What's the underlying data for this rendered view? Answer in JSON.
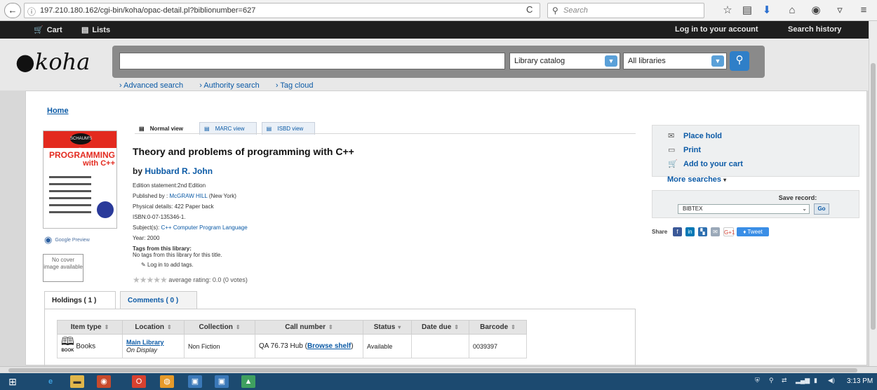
{
  "browser": {
    "back_glyph": "←",
    "info_glyph": "ⓘ",
    "url": "197.210.180.162/cgi-bin/koha/opac-detail.pl?biblionumber=627",
    "reload_glyph": "C",
    "search_placeholder": "Search",
    "toolbar_icons": [
      "star-icon",
      "reading-list-icon",
      "download-icon",
      "home-icon",
      "pocket-icon",
      "shield-icon",
      "menu-icon"
    ]
  },
  "topnav": {
    "cart_label": "Cart",
    "lists_label": "Lists",
    "login_label": "Log in to your account",
    "history_label": "Search history"
  },
  "header": {
    "logo_text": "koha",
    "search_value": "",
    "catalog_select": "Library catalog",
    "library_select": "All libraries",
    "more_links": [
      "Advanced search",
      "Authority search",
      "Tag cloud"
    ]
  },
  "main": {
    "breadcrumb": "Home",
    "views": [
      "Normal view",
      "MARC view",
      "ISBD view"
    ],
    "cover": {
      "brand": "SCHAUM'S outlines",
      "line1": "PROGRAMMING",
      "line2": "with C++"
    },
    "google_preview": "Google Preview",
    "no_cover": "No cover image available",
    "title": "Theory and problems of programming with C++",
    "author_prefix": "by",
    "author": "Hubbard R. John",
    "edition": "Edition statement:2nd Edition",
    "published_prefix": "Published by :",
    "publisher": "McGRAW HILL",
    "published_place": "(New York)",
    "physical": "Physical details: 422 Paper back",
    "isbn": "ISBN:0-07-135346-1.",
    "subject_prefix": "Subject(s):",
    "subject": "C++ Computer Program Language",
    "year": "Year: 2000",
    "tags_heading": "Tags from this library:",
    "tags_none": "No tags from this library for this title.",
    "tags_login": "Log in to add tags.",
    "rating_text": "average rating: 0.0 (0 votes)"
  },
  "sidebar": {
    "place_hold": "Place hold",
    "print": "Print",
    "add_to_cart": "Add to your cart",
    "more_searches": "More searches",
    "save_label": "Save record:",
    "save_format": "BIBTEX",
    "save_go": "Go",
    "share_label": "Share",
    "tweet_label": "Tweet",
    "gplus_label": "G+1"
  },
  "holdings": {
    "tab_holdings": "Holdings ( 1 )",
    "tab_comments": "Comments ( 0 )",
    "columns": [
      "Item type",
      "Location",
      "Collection",
      "Call number",
      "Status",
      "Date due",
      "Barcode"
    ],
    "row": {
      "item_type": "Books",
      "item_type_icon_label": "BOOK",
      "location": "Main Library",
      "location_sub": "On Display",
      "collection": "Non Fiction",
      "call_number": "QA 76.73 Hub",
      "browse": "Browse shelf",
      "status": "Available",
      "date_due": "",
      "barcode": "0039397"
    }
  },
  "taskbar": {
    "clock": "3:13 PM"
  }
}
